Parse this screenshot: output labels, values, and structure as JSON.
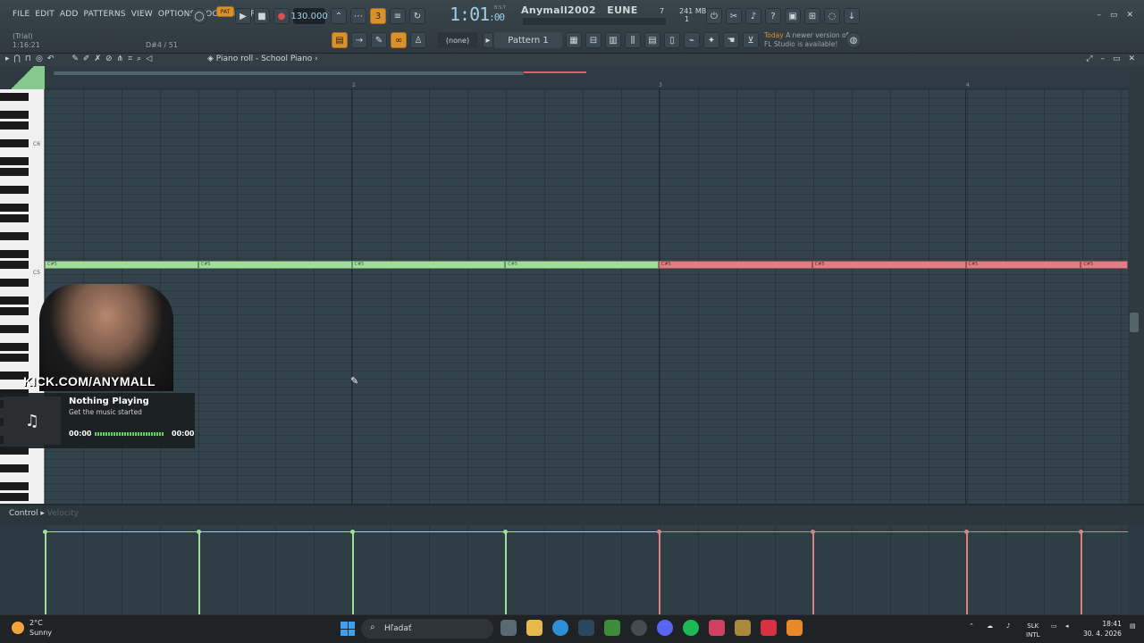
{
  "menu": [
    "FILE",
    "EDIT",
    "ADD",
    "PATTERNS",
    "VIEW",
    "OPTIONS",
    "TOOLS",
    "HELP"
  ],
  "trial": {
    "label": "(Trial)",
    "time": "1:16:21"
  },
  "note_info": "D#4 / 51",
  "transport": {
    "pat_label": "PAT",
    "bpm": "130.000",
    "time_main": "1:01",
    "time_sub": ":00",
    "time_sub2": "B:S:T"
  },
  "project": {
    "name": "Anymall2002",
    "server": "EUNE"
  },
  "memory": {
    "cores": "7",
    "mb": "241 MB",
    "voices": "1"
  },
  "pattern": {
    "none_label": "(none)",
    "name": "Pattern 1"
  },
  "news": {
    "today": "Today",
    "line1": "A newer version of",
    "line2": "FL Studio is available!"
  },
  "piano_roll": {
    "title": "Piano roll - School Piano",
    "bar_numbers": [
      "2",
      "3",
      "4"
    ],
    "key_labels": {
      "c6": "C6",
      "c5": "C5"
    }
  },
  "notes": {
    "label": "C#5",
    "green": [
      {
        "start": 0
      },
      {
        "start": 1
      },
      {
        "start": 2
      },
      {
        "start": 3
      }
    ],
    "red": [
      {
        "start": 4
      },
      {
        "start": 5
      },
      {
        "start": 6
      },
      {
        "start": 6.75
      }
    ]
  },
  "control": {
    "label": "Control",
    "target": "Velocity"
  },
  "overlay": {
    "kick": "KICK.COM/ANYMALL"
  },
  "now_playing": {
    "title": "Nothing Playing",
    "subtitle": "Get the music started",
    "time_left": "00:00",
    "time_right": "00:00",
    "note_glyph": "♫"
  },
  "taskbar": {
    "temp": "2°C",
    "condition": "Sunny",
    "search": "Hľadať",
    "lang1": "SLK",
    "lang2": "INTL",
    "time": "18:41",
    "date": "30. 4. 2026"
  },
  "colors": {
    "green_note": "#a3dd9c",
    "red_note": "#e07e88",
    "accent": "#d9922b"
  }
}
